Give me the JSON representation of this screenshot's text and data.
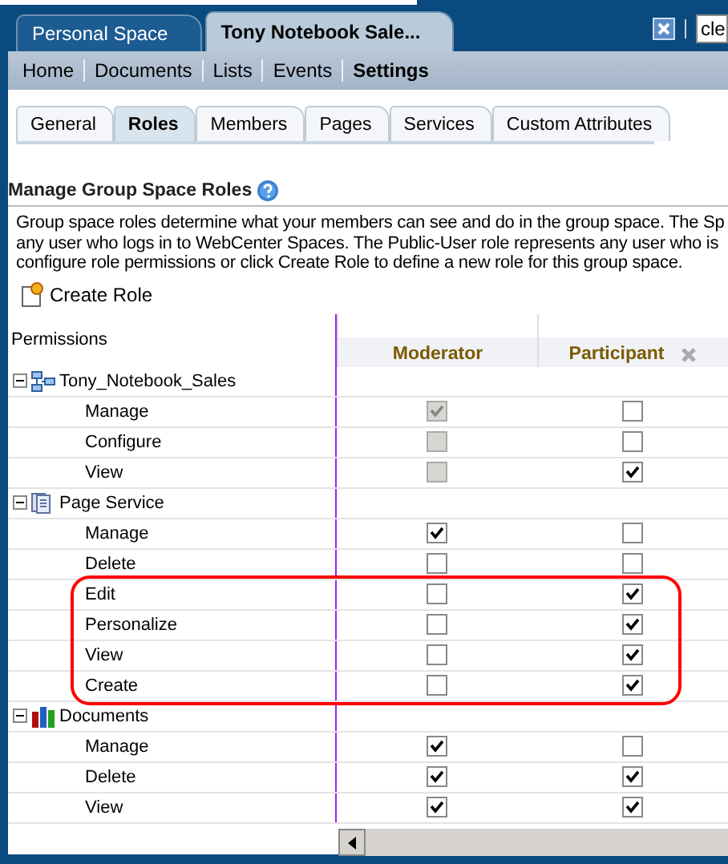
{
  "window_tabs": [
    {
      "label": "Personal Space",
      "selected": false
    },
    {
      "label": "Tony Notebook Sale...",
      "selected": true
    }
  ],
  "search": {
    "value": "cle"
  },
  "nav": [
    {
      "label": "Home",
      "selected": false
    },
    {
      "label": "Documents",
      "selected": false
    },
    {
      "label": "Lists",
      "selected": false
    },
    {
      "label": "Events",
      "selected": false
    },
    {
      "label": "Settings",
      "selected": true
    }
  ],
  "tabs": [
    {
      "label": "General",
      "selected": false
    },
    {
      "label": "Roles",
      "selected": true
    },
    {
      "label": "Members",
      "selected": false
    },
    {
      "label": "Pages",
      "selected": false
    },
    {
      "label": "Services",
      "selected": false
    },
    {
      "label": "Custom Attributes",
      "selected": false
    }
  ],
  "heading": "Manage Group Space Roles",
  "description": [
    "Group space roles determine what your members can see and do in the group space. The Sp",
    "any user who logs in to WebCenter Spaces. The Public-User role represents any user who is",
    "configure role permissions or click Create Role to define a new role for this group space."
  ],
  "create_button": "Create Role",
  "table": {
    "columns": [
      "Permissions",
      "Moderator",
      "Participant"
    ],
    "groups": [
      {
        "name": "Tony_Notebook_Sales",
        "kind": "space",
        "expanded": true,
        "rows": [
          {
            "name": "Manage",
            "cells": [
              {
                "checked": true,
                "disabled": true
              },
              {
                "checked": false,
                "disabled": false
              }
            ]
          },
          {
            "name": "Configure",
            "cells": [
              {
                "checked": false,
                "disabled": true
              },
              {
                "checked": false,
                "disabled": false
              }
            ]
          },
          {
            "name": "View",
            "cells": [
              {
                "checked": false,
                "disabled": true
              },
              {
                "checked": true,
                "disabled": false
              }
            ]
          }
        ]
      },
      {
        "name": "Page Service",
        "kind": "pages",
        "expanded": true,
        "rows": [
          {
            "name": "Manage",
            "cells": [
              {
                "checked": true,
                "disabled": false
              },
              {
                "checked": false,
                "disabled": false
              }
            ]
          },
          {
            "name": "Delete",
            "cells": [
              {
                "checked": false,
                "disabled": false
              },
              {
                "checked": false,
                "disabled": false
              }
            ]
          },
          {
            "name": "Edit",
            "cells": [
              {
                "checked": false,
                "disabled": false
              },
              {
                "checked": true,
                "disabled": false
              }
            ]
          },
          {
            "name": "Personalize",
            "cells": [
              {
                "checked": false,
                "disabled": false
              },
              {
                "checked": true,
                "disabled": false
              }
            ]
          },
          {
            "name": "View",
            "cells": [
              {
                "checked": false,
                "disabled": false
              },
              {
                "checked": true,
                "disabled": false
              }
            ]
          },
          {
            "name": "Create",
            "cells": [
              {
                "checked": false,
                "disabled": false
              },
              {
                "checked": true,
                "disabled": false
              }
            ]
          }
        ]
      },
      {
        "name": "Documents",
        "kind": "documents",
        "expanded": true,
        "rows": [
          {
            "name": "Manage",
            "cells": [
              {
                "checked": true,
                "disabled": false
              },
              {
                "checked": false,
                "disabled": false
              }
            ]
          },
          {
            "name": "Delete",
            "cells": [
              {
                "checked": true,
                "disabled": false
              },
              {
                "checked": true,
                "disabled": false
              }
            ]
          },
          {
            "name": "View",
            "cells": [
              {
                "checked": true,
                "disabled": false
              },
              {
                "checked": true,
                "disabled": false
              }
            ]
          }
        ]
      }
    ]
  }
}
